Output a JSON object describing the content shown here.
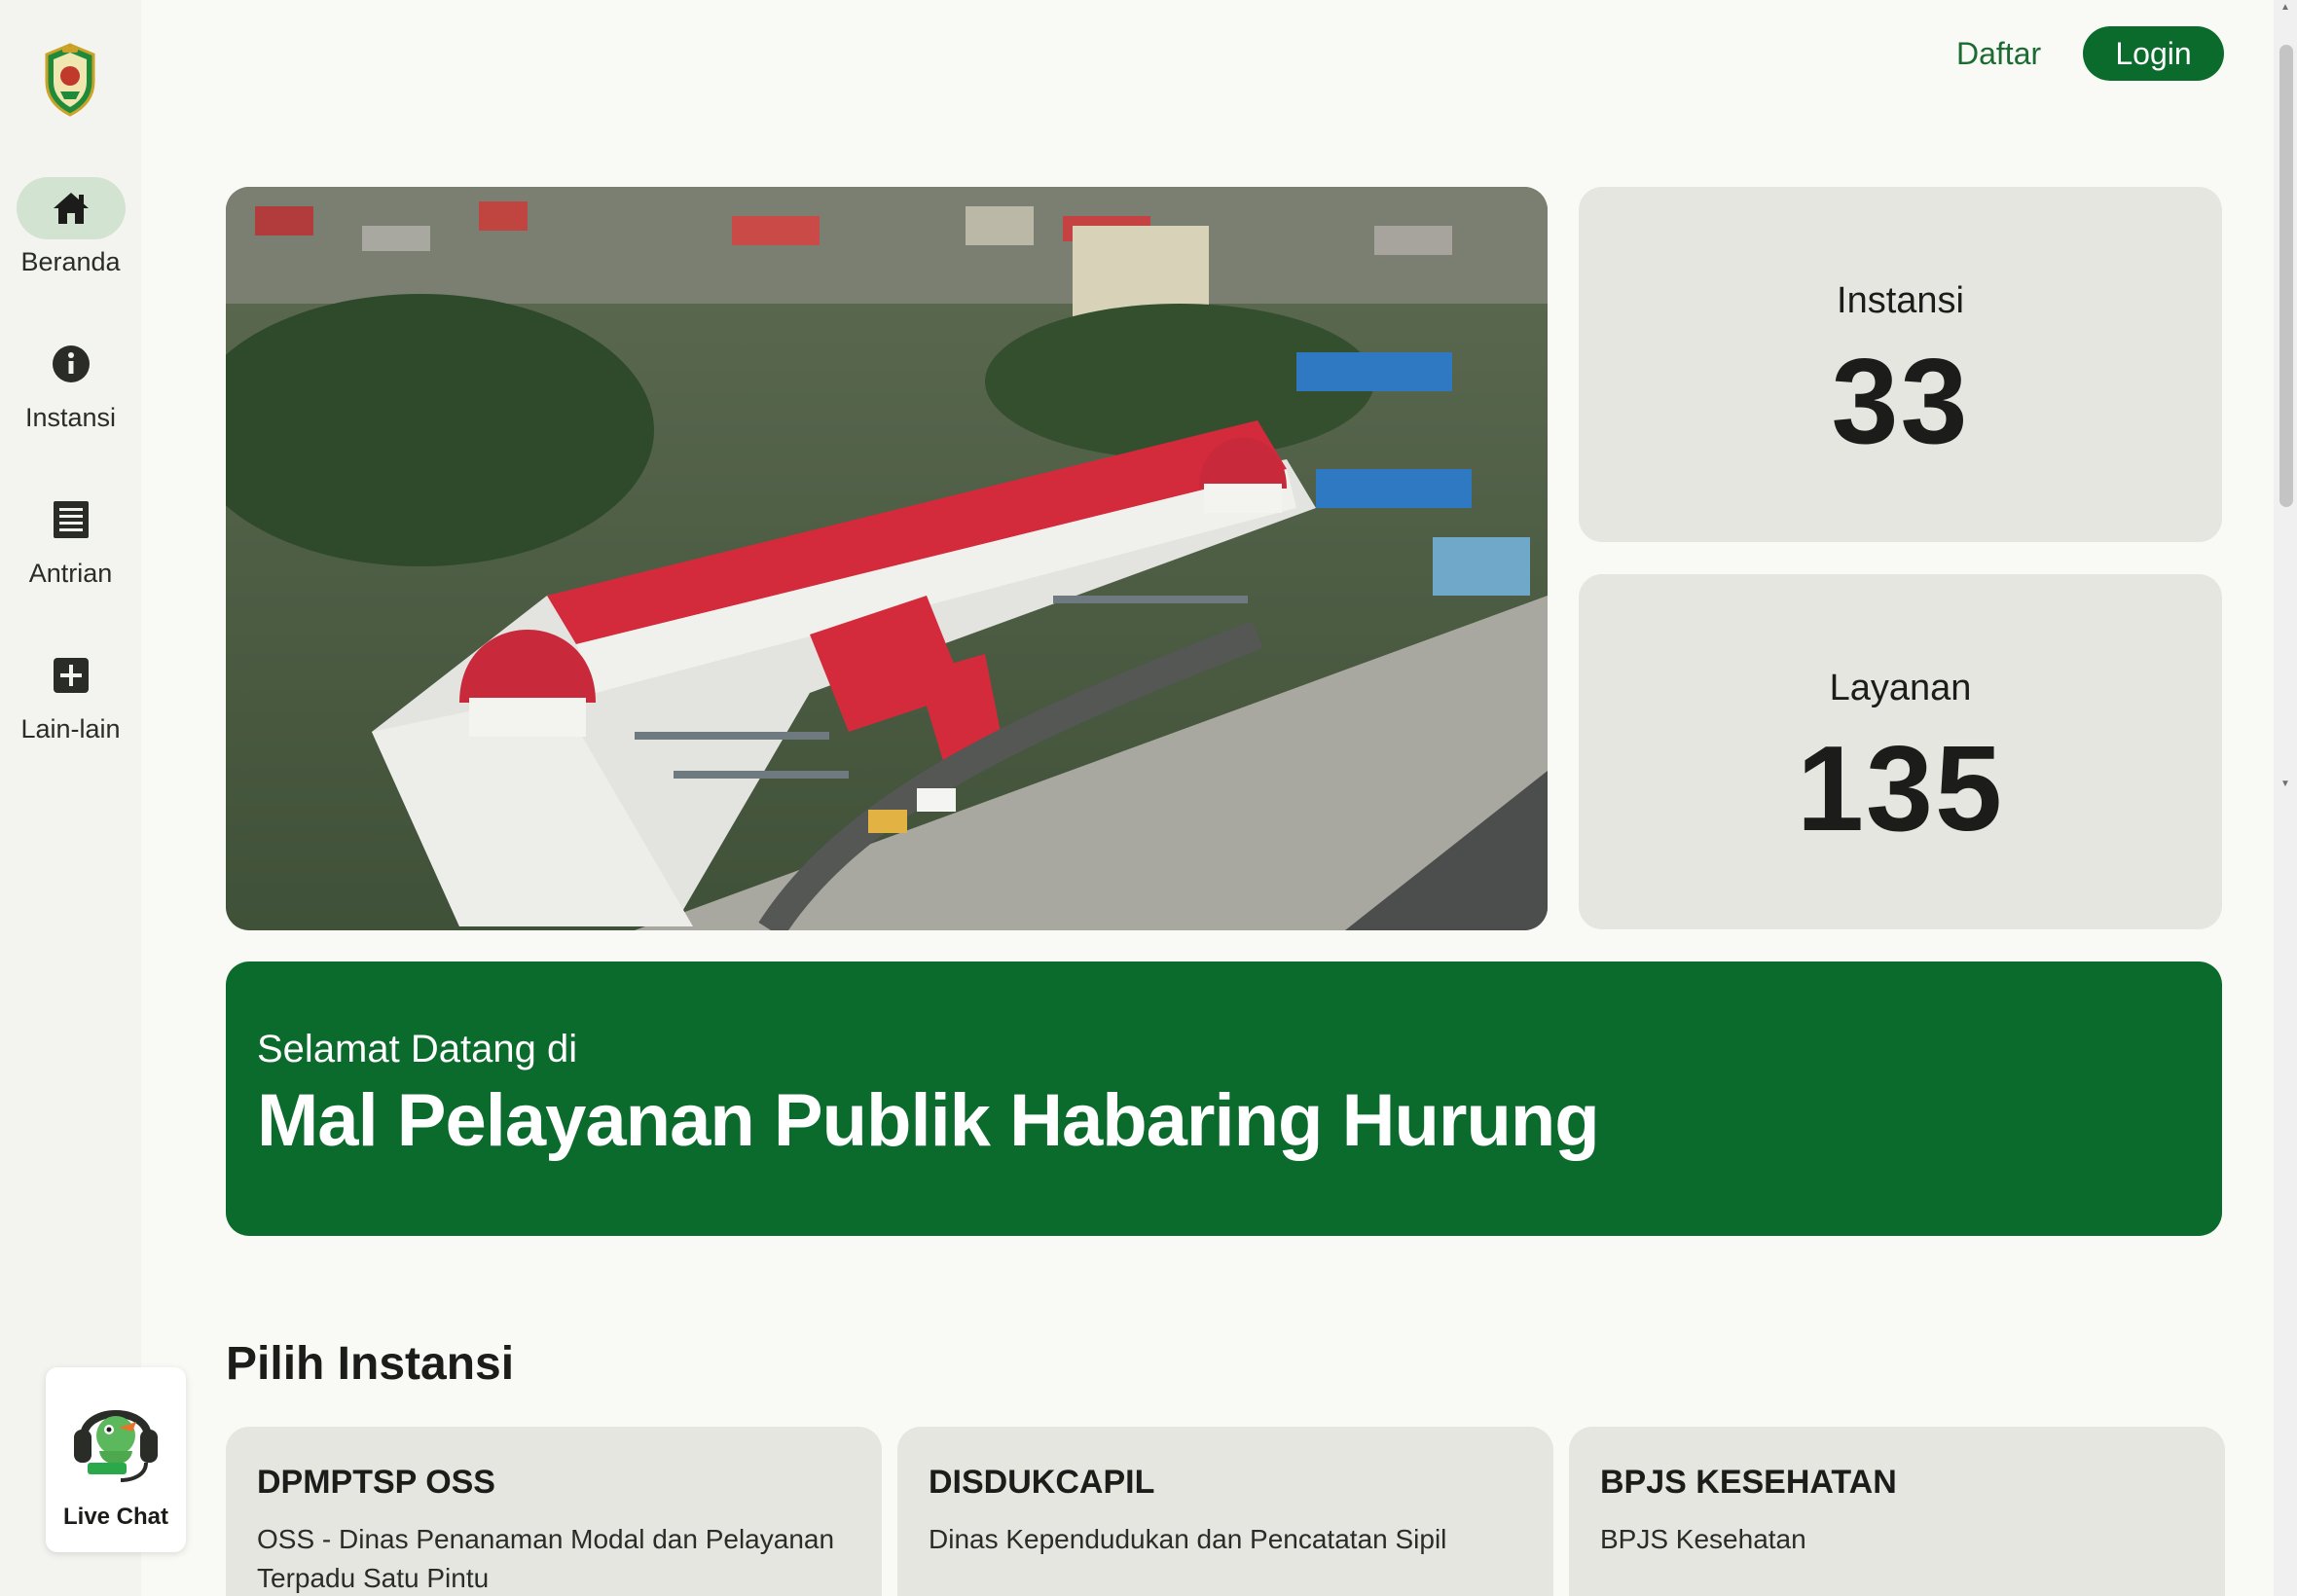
{
  "sidebar": {
    "items": [
      {
        "label": "Beranda",
        "icon": "home-icon",
        "active": true
      },
      {
        "label": "Instansi",
        "icon": "info-icon",
        "active": false
      },
      {
        "label": "Antrian",
        "icon": "list-icon",
        "active": false
      },
      {
        "label": "Lain-lain",
        "icon": "plus-box-icon",
        "active": false
      }
    ],
    "livechat_label": "Live Chat"
  },
  "header": {
    "register_label": "Daftar",
    "login_label": "Login"
  },
  "stats": [
    {
      "label": "Instansi",
      "value": "33"
    },
    {
      "label": "Layanan",
      "value": "135"
    }
  ],
  "welcome": {
    "subtitle": "Selamat Datang di",
    "title": "Mal Pelayanan Publik Habaring Hurung"
  },
  "section": {
    "title": "Pilih Instansi",
    "cards": [
      {
        "name": "DPMPTSP OSS",
        "description": "OSS - Dinas Penanaman Modal dan Pelayanan Terpadu Satu Pintu"
      },
      {
        "name": "DISDUKCAPIL",
        "description": "Dinas Kependudukan dan Pencatatan Sipil"
      },
      {
        "name": "BPJS KESEHATAN",
        "description": "BPJS Kesehatan"
      }
    ]
  },
  "colors": {
    "primary": "#0b6b2c",
    "card_bg": "#e6e6e1",
    "page_bg": "#f9faf5",
    "active_nav": "#d3e3d1"
  }
}
